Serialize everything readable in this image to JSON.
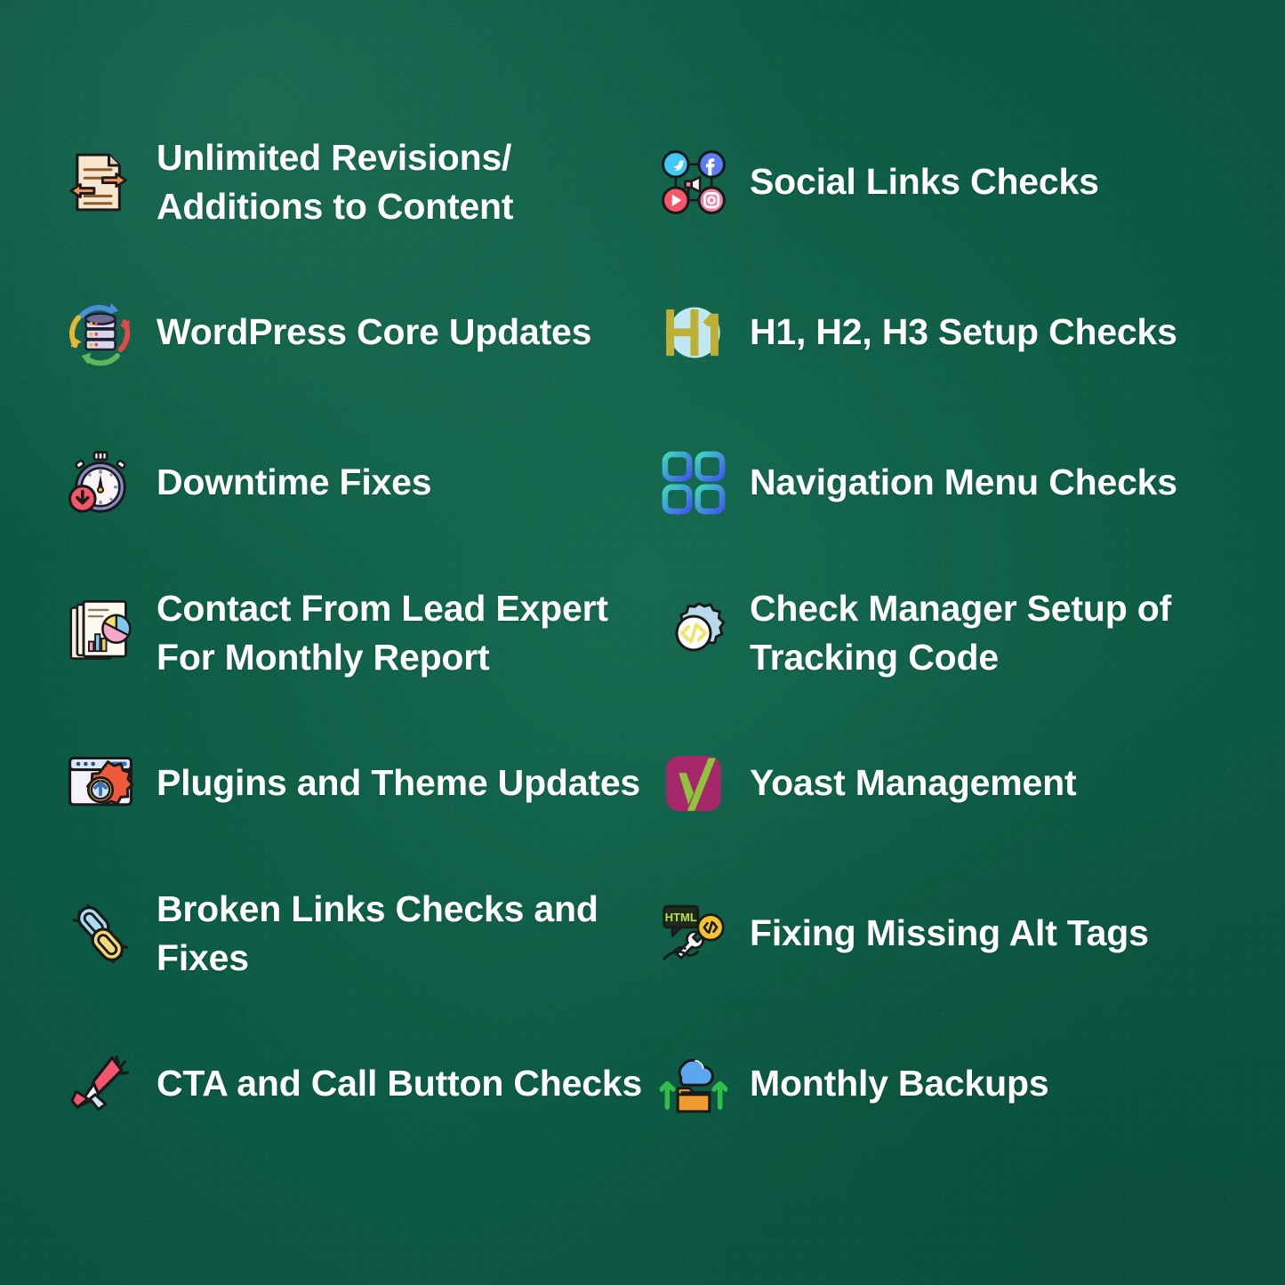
{
  "background": {
    "base_color": "#0f614a",
    "highlight_color": "#176a51",
    "shadow_color": "#0a5340"
  },
  "text_color": "#ffffff",
  "features": {
    "left_column": [
      {
        "icon": "document-revisions-icon",
        "label": "Unlimited Revisions/\nAdditions to Content"
      },
      {
        "icon": "database-refresh-icon",
        "label": "WordPress Core Updates"
      },
      {
        "icon": "stopwatch-downtime-icon",
        "label": "Downtime Fixes"
      },
      {
        "icon": "report-chart-icon",
        "label": "Contact From Lead Expert\nFor Monthly Report"
      },
      {
        "icon": "browser-gear-update-icon",
        "label": "Plugins and Theme Updates"
      },
      {
        "icon": "broken-chain-link-icon",
        "label": "Broken Links Checks and Fixes"
      },
      {
        "icon": "megaphone-icon",
        "label": "CTA and Call Button Checks"
      }
    ],
    "right_column": [
      {
        "icon": "social-links-icon",
        "label": "Social Links Checks"
      },
      {
        "icon": "heading-h1-icon",
        "label": "H1, H2, H3 Setup Checks"
      },
      {
        "icon": "menu-grid-icon",
        "label": "Navigation Menu Checks"
      },
      {
        "icon": "gear-code-icon",
        "label": "Check Manager Setup of\nTracking Code"
      },
      {
        "icon": "yoast-logo-icon",
        "label": "Yoast Management"
      },
      {
        "icon": "html-wrench-icon",
        "label": "Fixing Missing Alt Tags"
      },
      {
        "icon": "cloud-folder-backup-icon",
        "label": "Monthly Backups"
      }
    ]
  },
  "icon_colors": {
    "document_paper": "#f7e6cd",
    "document_line": "#8a5a2b",
    "arrow_orange": "#ef9256",
    "database_body": "#6e6b96",
    "arrow_blue": "#4a90d9",
    "arrow_red": "#e04a4a",
    "arrow_green": "#5cb85c",
    "arrow_yellow": "#e8b731",
    "twitter_cyan": "#42c8f4",
    "facebook_blue": "#5b7ef0",
    "youtube_red": "#f4566b",
    "instagram_pink": "#f07ea8",
    "h1_olive": "#bdb034",
    "h1_circle": "#bfe8f2",
    "menu_teal": "#3fd6bd",
    "menu_blue": "#4356f6",
    "gear_blue": "#b9d9ea",
    "code_yellow": "#f2e36a",
    "yoast_magenta": "#a4286a",
    "yoast_green": "#8fc33e",
    "chain_blue": "#aadcf2",
    "chain_yellow": "#f5d87a",
    "megaphone_red": "#f4566b",
    "megaphone_white": "#eef5fb",
    "html_green": "#b8e04a",
    "cloud_blue": "#5aa7f0",
    "folder_orange": "#f09c33",
    "up_arrow_green": "#2fbf4a",
    "plugin_red": "#f05a3c",
    "plugin_blue": "#5aa7f0"
  }
}
